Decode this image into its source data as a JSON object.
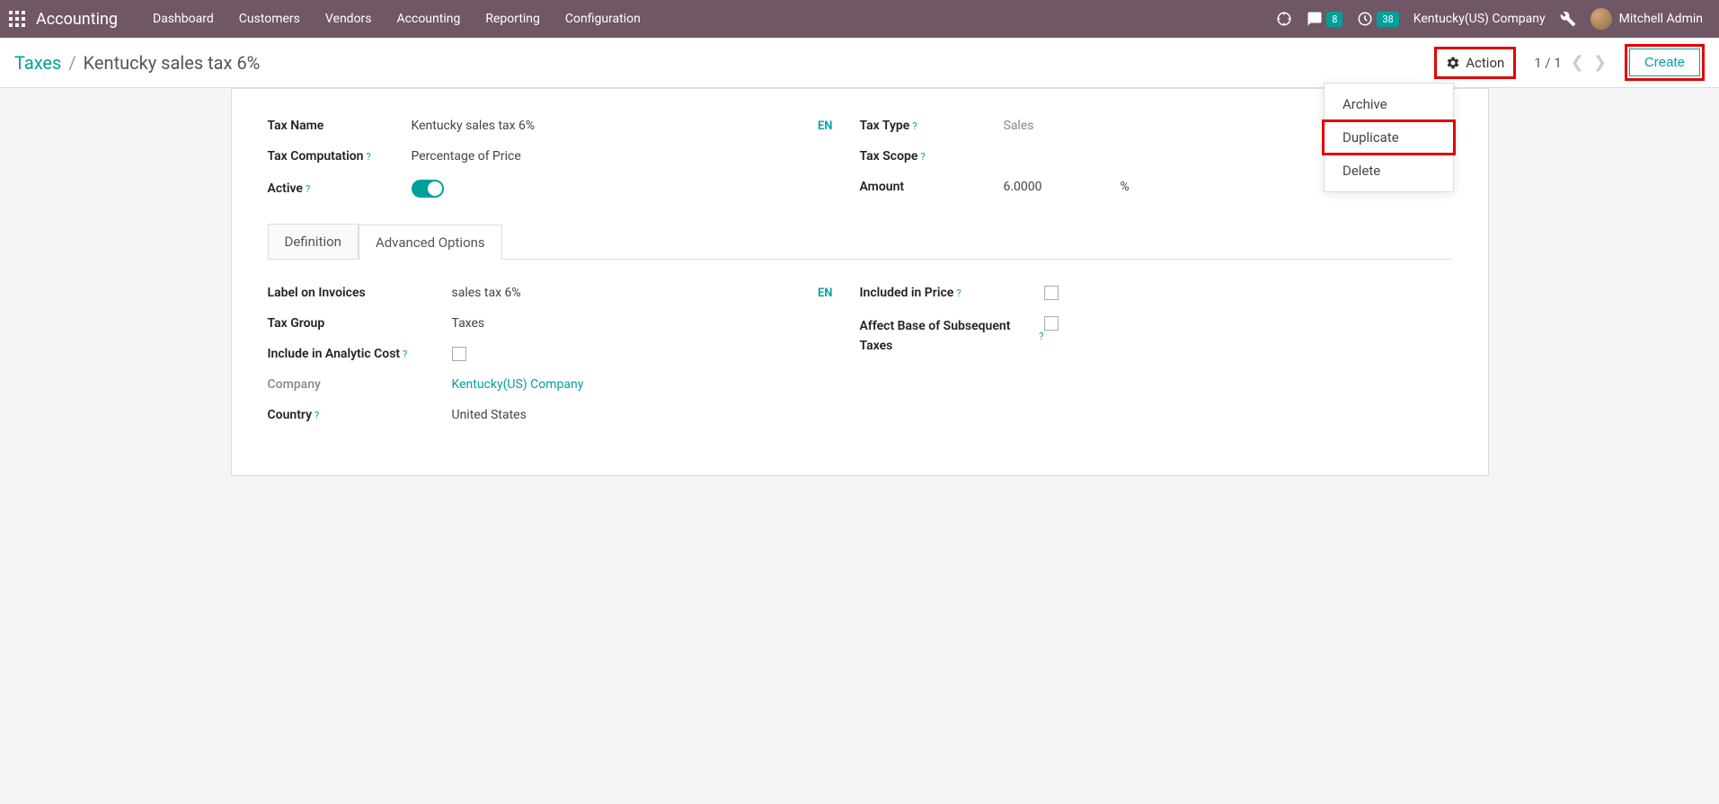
{
  "nav": {
    "app_name": "Accounting",
    "menus": [
      "Dashboard",
      "Customers",
      "Vendors",
      "Accounting",
      "Reporting",
      "Configuration"
    ],
    "messages_count": "8",
    "activities_count": "38",
    "company": "Kentucky(US) Company",
    "user": "Mitchell Admin"
  },
  "breadcrumb": {
    "parent": "Taxes",
    "current": "Kentucky sales tax 6%"
  },
  "control": {
    "action_label": "Action",
    "pager": "1 / 1",
    "create_label": "Create"
  },
  "dropdown": {
    "archive": "Archive",
    "duplicate": "Duplicate",
    "delete": "Delete"
  },
  "form": {
    "tax_name_label": "Tax Name",
    "tax_name_value": "Kentucky sales tax 6%",
    "tax_computation_label": "Tax Computation",
    "tax_computation_value": "Percentage of Price",
    "active_label": "Active",
    "tax_type_label": "Tax Type",
    "tax_type_value": "Sales",
    "tax_scope_label": "Tax Scope",
    "amount_label": "Amount",
    "amount_value": "6.0000",
    "amount_suffix": "%",
    "en": "EN"
  },
  "tabs": {
    "definition": "Definition",
    "advanced": "Advanced Options"
  },
  "advanced": {
    "label_on_invoices_label": "Label on Invoices",
    "label_on_invoices_value": "sales tax 6%",
    "tax_group_label": "Tax Group",
    "tax_group_value": "Taxes",
    "include_analytic_label": "Include in Analytic Cost",
    "company_label": "Company",
    "company_value": "Kentucky(US) Company",
    "country_label": "Country",
    "country_value": "United States",
    "included_price_label": "Included in Price",
    "affect_base_label": "Affect Base of Subsequent Taxes",
    "en": "EN"
  }
}
